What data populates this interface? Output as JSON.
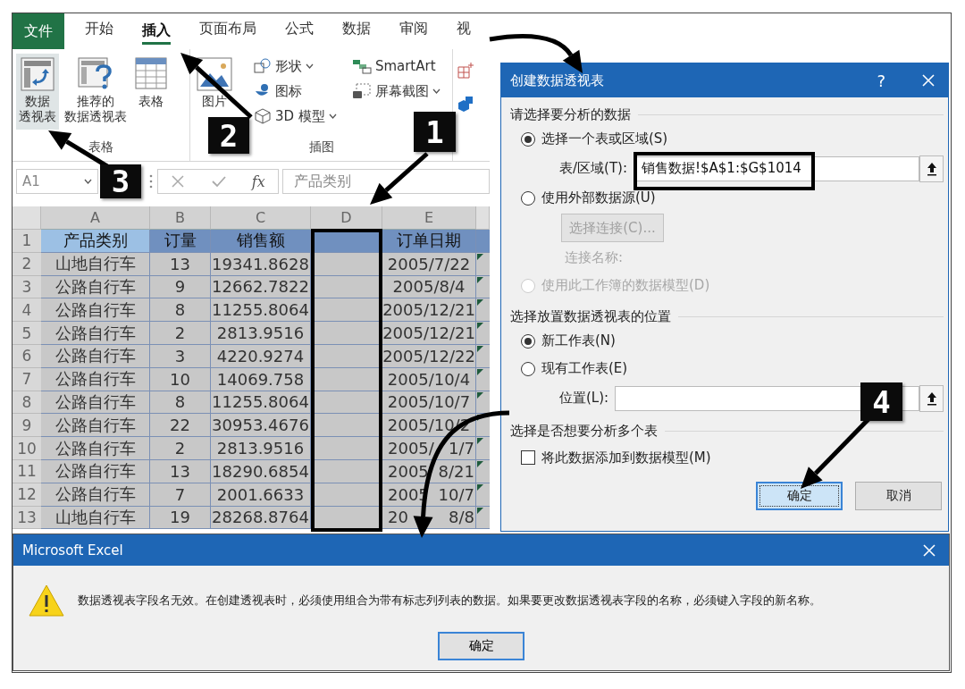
{
  "ribbon": {
    "tabs": [
      {
        "label": "文件",
        "kind": "file",
        "selected": false
      },
      {
        "label": "开始",
        "kind": "tab",
        "selected": false
      },
      {
        "label": "插入",
        "kind": "tab",
        "selected": true
      },
      {
        "label": "页面布局",
        "kind": "tab",
        "selected": false
      },
      {
        "label": "公式",
        "kind": "tab",
        "selected": false
      },
      {
        "label": "数据",
        "kind": "tab",
        "selected": false
      },
      {
        "label": "审阅",
        "kind": "tab",
        "selected": false
      },
      {
        "label": "视",
        "kind": "tab",
        "selected": false
      }
    ],
    "groups": [
      {
        "label": "表格",
        "buttons": [
          {
            "lines": [
              "数据",
              "透视表"
            ],
            "selected": true
          },
          {
            "lines": [
              "推荐的",
              "数据透视表"
            ],
            "selected": false
          },
          {
            "lines": [
              "表格"
            ],
            "selected": false
          }
        ]
      },
      {
        "label": "插图",
        "buttons": [
          {
            "lines": [
              "图片"
            ],
            "selected": false
          }
        ],
        "small_buttons": [
          {
            "label": "形状",
            "menu": true
          },
          {
            "label": "图标",
            "menu": false
          },
          {
            "label": "3D 模型",
            "menu": true
          },
          {
            "label": "SmartArt",
            "menu": false
          },
          {
            "label": "屏幕截图",
            "menu": true
          }
        ]
      }
    ]
  },
  "formula_bar": {
    "name_box": "A1",
    "function_label": "fx",
    "formula": "产品类别"
  },
  "sheet": {
    "columns": [
      "A",
      "B",
      "C",
      "D",
      "E"
    ],
    "rows": [
      {
        "num": "1",
        "kind": "header",
        "cells": [
          {
            "text": "产品类别",
            "selected": true
          },
          {
            "text": "订量",
            "selected": false
          },
          {
            "text": "销售额",
            "selected": false
          },
          {
            "selected": false
          },
          {
            "text": "订单日期",
            "selected": false
          }
        ]
      },
      {
        "num": "2",
        "kind": "data",
        "cells": [
          {
            "text": "山地自行车",
            "selected": false
          },
          {
            "text": "13",
            "selected": false
          },
          {
            "text": "19341.8628",
            "selected": false
          },
          {
            "selected": false
          },
          {
            "text": "2005/7/22",
            "selected": false
          }
        ]
      },
      {
        "num": "3",
        "kind": "data",
        "cells": [
          {
            "text": "公路自行车",
            "selected": false
          },
          {
            "text": "9",
            "selected": false
          },
          {
            "text": "12662.7822",
            "selected": false
          },
          {
            "selected": false
          },
          {
            "text": "2005/8/4",
            "selected": false
          }
        ]
      },
      {
        "num": "4",
        "kind": "data",
        "cells": [
          {
            "text": "公路自行车",
            "selected": false
          },
          {
            "text": "8",
            "selected": false
          },
          {
            "text": "11255.8064",
            "selected": false
          },
          {
            "selected": false
          },
          {
            "text": "2005/12/21",
            "selected": false
          }
        ]
      },
      {
        "num": "5",
        "kind": "data",
        "cells": [
          {
            "text": "公路自行车",
            "selected": false
          },
          {
            "text": "2",
            "selected": false
          },
          {
            "text": "2813.9516",
            "selected": false
          },
          {
            "selected": false
          },
          {
            "text": "2005/12/21",
            "selected": false
          }
        ]
      },
      {
        "num": "6",
        "kind": "data",
        "cells": [
          {
            "text": "公路自行车",
            "selected": false
          },
          {
            "text": "3",
            "selected": false
          },
          {
            "text": "4220.9274",
            "selected": false
          },
          {
            "selected": false
          },
          {
            "text": "2005/12/22",
            "selected": false
          }
        ]
      },
      {
        "num": "7",
        "kind": "data",
        "cells": [
          {
            "text": "公路自行车",
            "selected": false
          },
          {
            "text": "10",
            "selected": false
          },
          {
            "text": "14069.758",
            "selected": false
          },
          {
            "selected": false
          },
          {
            "text": "2005/10/4",
            "selected": false
          }
        ]
      },
      {
        "num": "8",
        "kind": "data",
        "cells": [
          {
            "text": "公路自行车",
            "selected": false
          },
          {
            "text": "8",
            "selected": false
          },
          {
            "text": "11255.8064",
            "selected": false
          },
          {
            "selected": false
          },
          {
            "text": "2005/10/7",
            "selected": false
          }
        ]
      },
      {
        "num": "9",
        "kind": "data",
        "cells": [
          {
            "text": "公路自行车",
            "selected": false
          },
          {
            "text": "22",
            "selected": false
          },
          {
            "text": "30953.4676",
            "selected": false
          },
          {
            "selected": false
          },
          {
            "text": "2005/10/2",
            "selected": false
          }
        ]
      },
      {
        "num": "10",
        "kind": "data",
        "cells": [
          {
            "text": "公路自行车",
            "selected": false
          },
          {
            "text": "2",
            "selected": false
          },
          {
            "text": "2813.9516",
            "selected": false
          },
          {
            "selected": false
          },
          {
            "text": "2005/",
            "tail": "1/7",
            "selected": false
          }
        ]
      },
      {
        "num": "11",
        "kind": "data",
        "cells": [
          {
            "text": "公路自行车",
            "selected": false
          },
          {
            "text": "13",
            "selected": false
          },
          {
            "text": "18290.6854",
            "selected": false
          },
          {
            "selected": false
          },
          {
            "text": "2005",
            "tail": "8/21",
            "selected": false
          }
        ]
      },
      {
        "num": "12",
        "kind": "data",
        "cells": [
          {
            "text": "公路自行车",
            "selected": false
          },
          {
            "text": "7",
            "selected": false
          },
          {
            "text": "2001.6633",
            "selected": false
          },
          {
            "selected": false
          },
          {
            "text": "2005",
            "tail": "10/7",
            "selected": false
          }
        ]
      },
      {
        "num": "13",
        "kind": "data",
        "cells": [
          {
            "text": "山地自行车",
            "selected": false
          },
          {
            "text": "19",
            "selected": false
          },
          {
            "text": "28268.8764",
            "selected": false
          },
          {
            "selected": false
          },
          {
            "text": "20",
            "tail": "8/8",
            "selected": false
          }
        ]
      }
    ]
  },
  "pivot_dialog": {
    "title": "创建数据透视表",
    "help": "?",
    "sections": [
      {
        "heading": "请选择要分析的数据",
        "items": [
          {
            "kind": "radio",
            "label": "选择一个表或区域(S)",
            "selected": true,
            "disabled": false
          },
          {
            "kind": "field",
            "label": "表/区域(T):",
            "value": "销售数据!$A$1:$G$1014"
          },
          {
            "kind": "radio",
            "label": "使用外部数据源(U)",
            "selected": false,
            "disabled": false
          },
          {
            "kind": "button",
            "label": "选择连接(C)...",
            "disabled": true
          },
          {
            "kind": "note",
            "label": "连接名称:",
            "disabled": true
          },
          {
            "kind": "radio",
            "label": "使用此工作簿的数据模型(D)",
            "selected": false,
            "disabled": true
          }
        ]
      },
      {
        "heading": "选择放置数据透视表的位置",
        "items": [
          {
            "kind": "radio",
            "label": "新工作表(N)",
            "selected": true,
            "disabled": false
          },
          {
            "kind": "radio",
            "label": "现有工作表(E)",
            "selected": false,
            "disabled": false
          },
          {
            "kind": "field",
            "label": "位置(L):"
          }
        ]
      },
      {
        "heading": "选择是否想要分析多个表",
        "items": [
          {
            "kind": "checkbox",
            "label": "将此数据添加到数据模型(M)",
            "checked": false
          }
        ]
      }
    ],
    "buttons": [
      {
        "label": "确定",
        "default": true
      },
      {
        "label": "取消",
        "default": false
      }
    ]
  },
  "message_box": {
    "title": "Microsoft Excel",
    "message": "数据透视表字段名无效。在创建透视表时，必须使用组合为带有标志列列表的数据。如果要更改数据透视表字段的名称，必须键入字段的新名称。",
    "button": "确定"
  },
  "callouts": [
    {
      "label": "1"
    },
    {
      "label": "2"
    },
    {
      "label": "3"
    },
    {
      "label": "4"
    }
  ]
}
